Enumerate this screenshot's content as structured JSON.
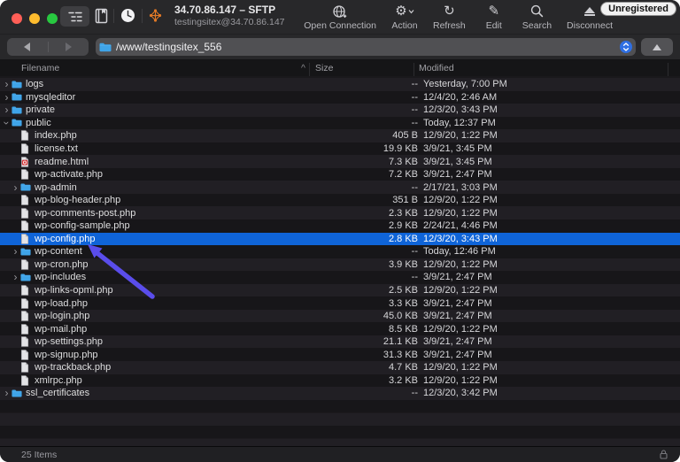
{
  "window": {
    "title": "34.70.86.147 – SFTP",
    "subtitle": "testingsitex@34.70.86.147",
    "badge": "Unregistered"
  },
  "toolbar": {
    "left_icons": [
      "outline-view-icon",
      "bookmarks-book-icon",
      "history-clock-icon",
      "bonjour-icon"
    ],
    "buttons": [
      {
        "label": "Open Connection",
        "icon": "globe-plus-icon"
      },
      {
        "label": "Action",
        "icon": "gear-icon"
      },
      {
        "label": "Refresh",
        "icon": "refresh-icon"
      },
      {
        "label": "Edit",
        "icon": "pencil-icon"
      },
      {
        "label": "Search",
        "icon": "search-icon"
      },
      {
        "label": "Disconnect",
        "icon": "eject-icon"
      }
    ]
  },
  "pathbar": {
    "path": "/www/testingsitex_556",
    "icons": [
      "back-icon",
      "forward-icon",
      "folder-icon",
      "stepper-icon",
      "up-directory-icon"
    ]
  },
  "columns": {
    "filename": "Filename",
    "size": "Size",
    "modified": "Modified",
    "sort_indicator": "^"
  },
  "files": [
    {
      "name": "logs",
      "type": "folder",
      "level": 1,
      "expanded": false,
      "size": "--",
      "modified": "Yesterday, 7:00 PM"
    },
    {
      "name": "mysqleditor",
      "type": "folder",
      "level": 1,
      "expanded": false,
      "size": "--",
      "modified": "12/4/20, 2:46 AM"
    },
    {
      "name": "private",
      "type": "folder",
      "level": 1,
      "expanded": false,
      "size": "--",
      "modified": "12/3/20, 3:43 PM"
    },
    {
      "name": "public",
      "type": "folder",
      "level": 1,
      "expanded": true,
      "size": "--",
      "modified": "Today, 12:37 PM"
    },
    {
      "name": "index.php",
      "type": "file",
      "level": 2,
      "size": "405 B",
      "modified": "12/9/20, 1:22 PM"
    },
    {
      "name": "license.txt",
      "type": "file",
      "level": 2,
      "size": "19.9 KB",
      "modified": "3/9/21, 3:45 PM"
    },
    {
      "name": "readme.html",
      "type": "html",
      "level": 2,
      "size": "7.3 KB",
      "modified": "3/9/21, 3:45 PM"
    },
    {
      "name": "wp-activate.php",
      "type": "file",
      "level": 2,
      "size": "7.2 KB",
      "modified": "3/9/21, 2:47 PM"
    },
    {
      "name": "wp-admin",
      "type": "folder",
      "level": 2,
      "expanded": false,
      "size": "--",
      "modified": "2/17/21, 3:03 PM"
    },
    {
      "name": "wp-blog-header.php",
      "type": "file",
      "level": 2,
      "size": "351 B",
      "modified": "12/9/20, 1:22 PM"
    },
    {
      "name": "wp-comments-post.php",
      "type": "file",
      "level": 2,
      "size": "2.3 KB",
      "modified": "12/9/20, 1:22 PM"
    },
    {
      "name": "wp-config-sample.php",
      "type": "file",
      "level": 2,
      "size": "2.9 KB",
      "modified": "2/24/21, 4:46 PM"
    },
    {
      "name": "wp-config.php",
      "type": "file",
      "level": 2,
      "size": "2.8 KB",
      "modified": "12/3/20, 3:43 PM",
      "selected": true
    },
    {
      "name": "wp-content",
      "type": "folder",
      "level": 2,
      "expanded": false,
      "size": "--",
      "modified": "Today, 12:46 PM"
    },
    {
      "name": "wp-cron.php",
      "type": "file",
      "level": 2,
      "size": "3.9 KB",
      "modified": "12/9/20, 1:22 PM"
    },
    {
      "name": "wp-includes",
      "type": "folder",
      "level": 2,
      "expanded": false,
      "size": "--",
      "modified": "3/9/21, 2:47 PM"
    },
    {
      "name": "wp-links-opml.php",
      "type": "file",
      "level": 2,
      "size": "2.5 KB",
      "modified": "12/9/20, 1:22 PM"
    },
    {
      "name": "wp-load.php",
      "type": "file",
      "level": 2,
      "size": "3.3 KB",
      "modified": "3/9/21, 2:47 PM"
    },
    {
      "name": "wp-login.php",
      "type": "file",
      "level": 2,
      "size": "45.0 KB",
      "modified": "3/9/21, 2:47 PM"
    },
    {
      "name": "wp-mail.php",
      "type": "file",
      "level": 2,
      "size": "8.5 KB",
      "modified": "12/9/20, 1:22 PM"
    },
    {
      "name": "wp-settings.php",
      "type": "file",
      "level": 2,
      "size": "21.1 KB",
      "modified": "3/9/21, 2:47 PM"
    },
    {
      "name": "wp-signup.php",
      "type": "file",
      "level": 2,
      "size": "31.3 KB",
      "modified": "3/9/21, 2:47 PM"
    },
    {
      "name": "wp-trackback.php",
      "type": "file",
      "level": 2,
      "size": "4.7 KB",
      "modified": "12/9/20, 1:22 PM"
    },
    {
      "name": "xmlrpc.php",
      "type": "file",
      "level": 2,
      "size": "3.2 KB",
      "modified": "12/9/20, 1:22 PM"
    },
    {
      "name": "ssl_certificates",
      "type": "folder",
      "level": 1,
      "expanded": false,
      "size": "--",
      "modified": "12/3/20, 3:42 PM"
    }
  ],
  "statusbar": {
    "items": "25 Items",
    "icon": "lock-icon"
  },
  "annotation": {
    "type": "arrow",
    "points_at": "wp-config.php",
    "color": "#5a4deb"
  },
  "colors": {
    "selection_blue": "#0f64d8",
    "arrow_purple": "#5a4deb",
    "folder_blue": "#3fa4e8",
    "stepper_blue": "#2f6fe3",
    "traffic_red": "#ff5f57",
    "traffic_yellow": "#febc2e",
    "traffic_green": "#28c840"
  }
}
